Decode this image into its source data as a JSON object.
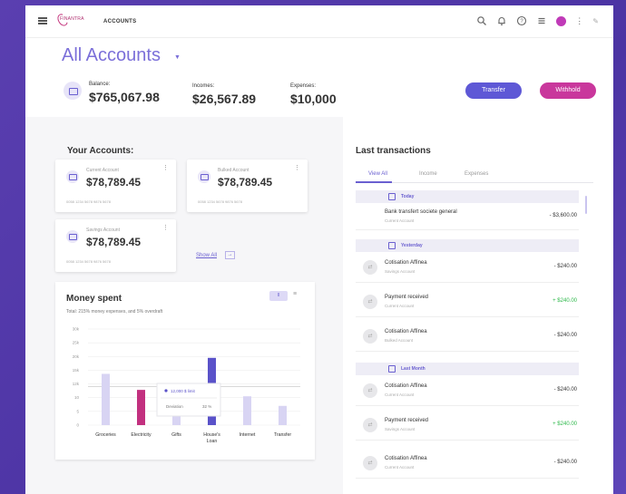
{
  "topbar": {
    "logo_text": "FINANTRA",
    "section": "ACCOUNTS"
  },
  "icons": {
    "menu": "hamburger-icon",
    "search": "search-icon",
    "notifications": "bell-icon",
    "help": "help-icon",
    "apps": "list-icon",
    "profile": "avatar-icon",
    "more": "more-vertical-icon",
    "edit": "pencil-icon"
  },
  "header": {
    "title": "All Accounts",
    "balance_label": "Balance:",
    "balance_value": "$765,067.98",
    "incomes_label": "Incomes:",
    "incomes_value": "$26,567.89",
    "expenses_label": "Expenses:",
    "expenses_value": "$10,000",
    "transfer_label": "Transfer",
    "withhold_label": "Withhold"
  },
  "accounts": {
    "title": "Your Accounts:",
    "show_all": "Show All",
    "items": [
      {
        "name": "Current Account",
        "amount": "$78,789.45",
        "number": "0058 1234 5678 9876 5678"
      },
      {
        "name": "Bulked Account",
        "amount": "$78,789.45",
        "number": "0058 1234 5678 9876 5678"
      },
      {
        "name": "Savings Account",
        "amount": "$78,789.45",
        "number": "0058 1234 5678 9876 5678"
      }
    ]
  },
  "money_spent": {
    "title": "Money spent",
    "subtitle": "Total: 215% money expenses, and 5% overdraft",
    "toggle_label": "II",
    "tooltip_value": "12,000 $ limit",
    "tooltip_label": "Deviation",
    "tooltip_pct": "32 %"
  },
  "chart_data": {
    "type": "bar",
    "categories": [
      "Groceries",
      "Electricity",
      "Gifts",
      "House's Loan",
      "Internet",
      "Transfer"
    ],
    "series": [
      {
        "values": [
          16,
          11,
          6,
          21,
          9,
          6
        ]
      }
    ],
    "highlight": {
      "Electricity": "#c2307f",
      "House's Loan": "#5a52c9"
    },
    "yticks": [
      "0",
      "5",
      "10",
      "12k",
      "15k",
      "20k",
      "25k",
      "30k"
    ],
    "ylim": [
      0,
      30
    ],
    "reference_line": 12,
    "colors": {
      "default": "#d8d4f3",
      "magenta": "#c2307f",
      "purple": "#5a52c9"
    }
  },
  "transactions": {
    "title": "Last transactions",
    "tabs": [
      "View All",
      "Income",
      "Expenses"
    ],
    "groups": [
      {
        "date": "Today",
        "items": [
          {
            "name": "Bank transfert societe general",
            "account": "Current Account",
            "amount": "- $3,600.00",
            "positive": false
          }
        ]
      },
      {
        "date": "Yesterday",
        "items": [
          {
            "name": "Cotisation Affinea",
            "account": "Savings Account",
            "amount": "- $240.00",
            "positive": false
          },
          {
            "name": "Payment received",
            "account": "Current Account",
            "amount": "+ $240.00",
            "positive": true
          },
          {
            "name": "Cotisation Affinea",
            "account": "Bulked Account",
            "amount": "- $240.00",
            "positive": false
          }
        ]
      },
      {
        "date": "Last Month",
        "items": [
          {
            "name": "Cotisation Affinea",
            "account": "Current Account",
            "amount": "- $240.00",
            "positive": false
          },
          {
            "name": "Payment received",
            "account": "Savings Account",
            "amount": "+ $240.00",
            "positive": true
          },
          {
            "name": "Cotisation Affinea",
            "account": "Current Account",
            "amount": "- $240.00",
            "positive": false
          }
        ]
      }
    ]
  }
}
